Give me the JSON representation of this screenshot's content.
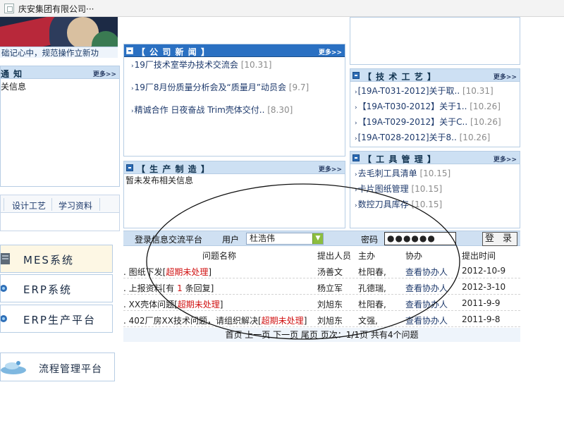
{
  "window": {
    "title": "庆安集团有限公司···"
  },
  "banner": {
    "caption": "础记心中，规范操作立新功"
  },
  "notice": {
    "title": "通 知",
    "more": "更多>>",
    "text": "关信息"
  },
  "tabs": [
    "设计工艺",
    "学习资料"
  ],
  "systems": [
    {
      "label": "MES系统"
    },
    {
      "label": "ERP系统"
    },
    {
      "label": "ERP生产平台"
    },
    {
      "label": "流程管理平台"
    }
  ],
  "news": {
    "title": "【 公 司 新 闻 】",
    "more": "更多>>",
    "items": [
      {
        "text": "19厂技术室举办技术交流会",
        "date": "[10.31]"
      },
      {
        "text": "19厂8月份质量分析会及“质量月”动员会",
        "date": "[9.7]"
      },
      {
        "text": "精诚合作 日夜奋战 Trim壳体交付..",
        "date": "[8.30]"
      }
    ]
  },
  "production": {
    "title": "【 生 产 制 造 】",
    "more": "更多>>",
    "text": "暂未发布相关信息"
  },
  "tech": {
    "title": "【 技 术 工 艺 】",
    "more": "更多>>",
    "items": [
      {
        "text": "[19A-T031-2012]关于取..",
        "date": "[10.31]"
      },
      {
        "text": "【19A-T030-2012】关于1..",
        "date": "[10.26]"
      },
      {
        "text": "【19A-T029-2012】关于C..",
        "date": "[10.26]"
      },
      {
        "text": "[19A-T028-2012]关于8..",
        "date": "[10.26]"
      }
    ]
  },
  "tools": {
    "title": "【 工 具 管 理 】",
    "more": "更多>>",
    "items": [
      {
        "text": "去毛刺工具清单",
        "date": "[10.15]"
      },
      {
        "text": "卡片图纸管理",
        "date": "[10.15]"
      },
      {
        "text": "数控刀具库存",
        "date": "[10.15]"
      }
    ]
  },
  "login": {
    "platform": "登录信息交流平台",
    "user_label": "用户",
    "user_value": "杜浩伟",
    "password_label": "密码",
    "password_value": "●●●●●●",
    "button": "登 录"
  },
  "table": {
    "headers": [
      "问题名称",
      "提出人员",
      "主办",
      "协办",
      "提出时间"
    ],
    "rows": [
      {
        "name": ". 图纸下发[",
        "status": "超期未处理",
        "close": "]",
        "by": "汤善文",
        "host": "杜阳春,",
        "assist": "查看协办人",
        "date": "2012-10-9"
      },
      {
        "name": ". 上报资料[有 ",
        "count": "1",
        "tail": " 条回复]",
        "by": "杨立军",
        "host": "孔德瑞,",
        "assist": "查看协办人",
        "date": "2012-3-10"
      },
      {
        "name": ". XX壳体问题[",
        "status": "超期未处理",
        "close": "]",
        "by": "刘旭东",
        "host": "杜阳春,",
        "assist": "查看协办人",
        "date": "2011-9-9"
      },
      {
        "name": ". 402厂房XX技术问题，请组织解决[",
        "status": "超期未处理",
        "close": "]",
        "by": "刘旭东",
        "host": "文强,",
        "assist": "查看协办人",
        "date": "2011-9-8"
      }
    ],
    "pager": "首页  上一页  下一页  尾页  页次：1/1页  共有4个问题"
  }
}
